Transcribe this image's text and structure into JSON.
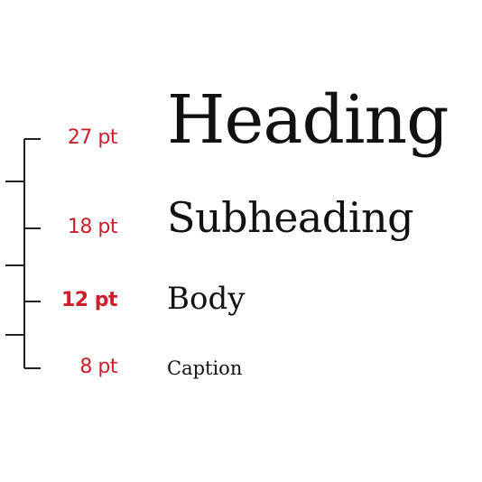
{
  "scale": {
    "accent_color": "#cc1f2b",
    "text_color": "#111111",
    "levels": [
      {
        "size_label": "27 pt",
        "sample_text": "Heading",
        "emphasized": false
      },
      {
        "size_label": "18 pt",
        "sample_text": "Subheading",
        "emphasized": false
      },
      {
        "size_label": "12 pt",
        "sample_text": "Body",
        "emphasized": true
      },
      {
        "size_label": "8 pt",
        "sample_text": "Caption",
        "emphasized": false
      }
    ]
  }
}
